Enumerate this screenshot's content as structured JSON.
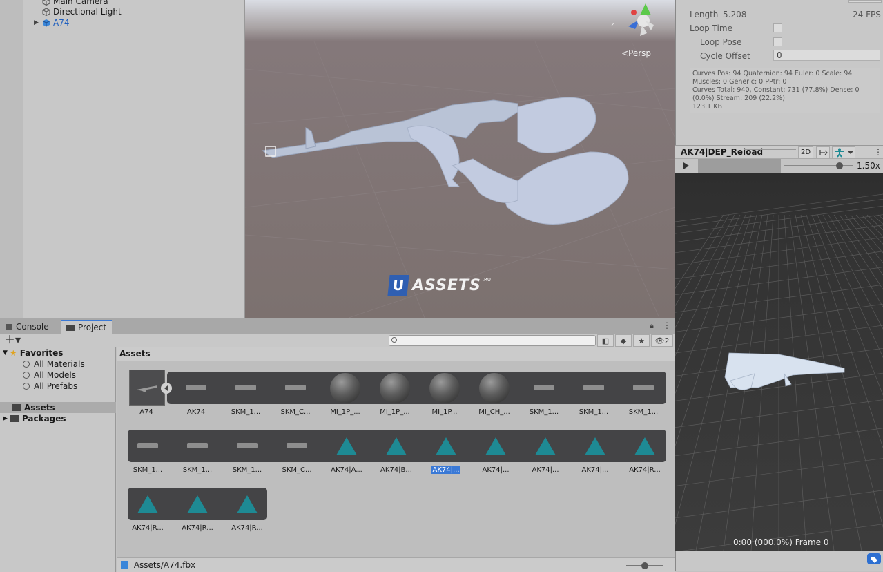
{
  "hierarchy": {
    "items": [
      {
        "label": "Main Camera"
      },
      {
        "label": "Directional Light"
      },
      {
        "label": "A74"
      }
    ]
  },
  "scene": {
    "persp_label": "<Persp",
    "gizmo_axis": "z",
    "watermark_letter": "U",
    "watermark_text": "ASSETS",
    "watermark_suffix": ".RU"
  },
  "inspector": {
    "length_label": "Length",
    "length_value": "5.208",
    "fps": "24 FPS",
    "loop_time": "Loop Time",
    "loop_pose": "Loop Pose",
    "cycle_offset": "Cycle Offset",
    "cycle_offset_value": "0",
    "info_lines": [
      "Curves Pos: 94 Quaternion: 94 Euler: 0 Scale: 94",
      "Muscles: 0 Generic: 0 PPtr: 0",
      "Curves Total: 940, Constant: 731 (77.8%) Dense: 0",
      "(0.0%) Stream: 209 (22.2%)",
      "123.1 KB"
    ]
  },
  "preview": {
    "clip_name": "AK74|DEP_Reload",
    "mode_2d": "2D",
    "speed": "1.50x",
    "speed_fraction": 0.8,
    "time_label": "0:00 (000.0%) Frame 0"
  },
  "bottom": {
    "tabs": [
      {
        "label": "Console"
      },
      {
        "label": "Project"
      }
    ],
    "hidden_count": "2",
    "favorites": {
      "label": "Favorites",
      "items": [
        "All Materials",
        "All Models",
        "All Prefabs"
      ]
    },
    "folders": [
      "Assets",
      "Packages"
    ],
    "assets_header": "Assets",
    "footer_path": "Assets/A74.fbx",
    "row1": [
      "A74",
      "AK74",
      "SKM_1...",
      "SKM_C...",
      "MI_1P_...",
      "MI_1P_...",
      "MI_1P...",
      "MI_CH_...",
      "SKM_1...",
      "SKM_1...",
      "SKM_1..."
    ],
    "row2": [
      "SKM_1...",
      "SKM_1...",
      "SKM_1...",
      "SKM_C...",
      "AK74|A...",
      "AK74|B...",
      "AK74|...",
      "AK74|...",
      "AK74|...",
      "AK74|...",
      "AK74|R..."
    ],
    "row3": [
      "AK74|R...",
      "AK74|R...",
      "AK74|R..."
    ]
  },
  "colors": {
    "accent": "#3a79d6",
    "anim_icon": "#1e8a94",
    "scene_bg": "#7c716f"
  }
}
